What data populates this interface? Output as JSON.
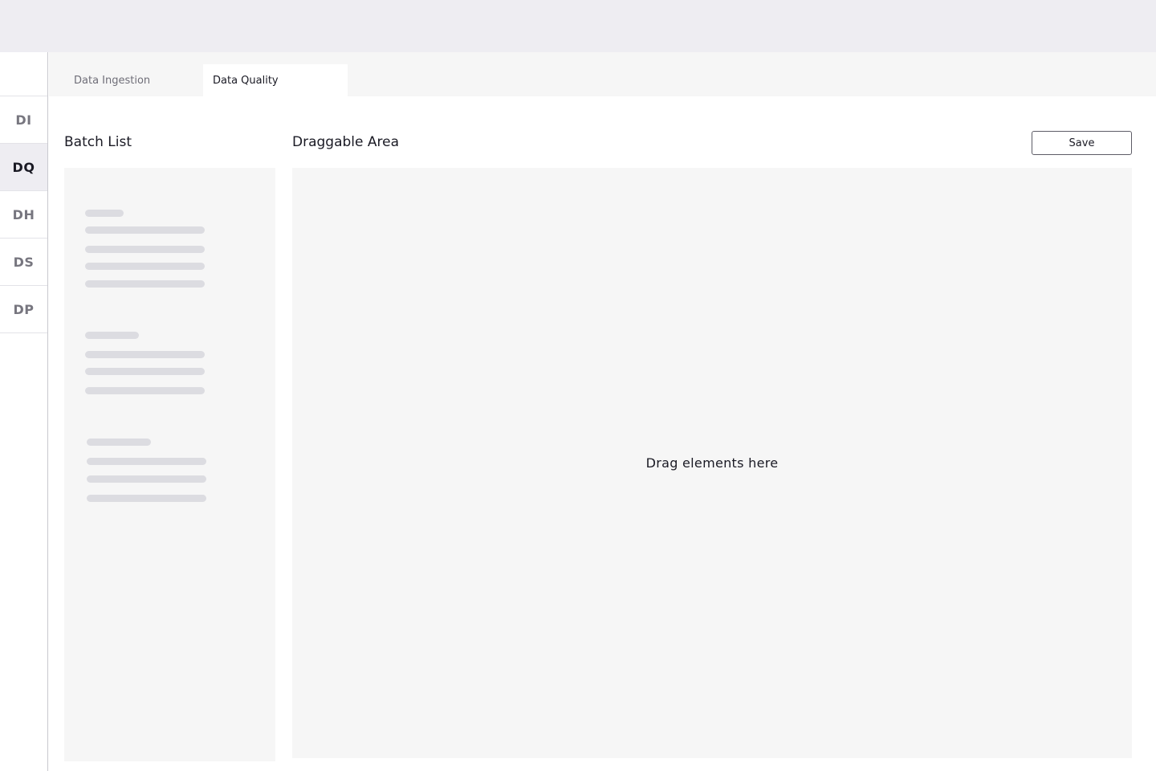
{
  "sidebar": {
    "items": [
      {
        "label": "DI",
        "active": false
      },
      {
        "label": "DQ",
        "active": true
      },
      {
        "label": "DH",
        "active": false
      },
      {
        "label": "DS",
        "active": false
      },
      {
        "label": "DP",
        "active": false
      }
    ]
  },
  "tabs": [
    {
      "label": "Data Ingestion",
      "active": false
    },
    {
      "label": "Data Quality",
      "active": true
    }
  ],
  "batch_list": {
    "title": "Batch List",
    "loading": true
  },
  "draggable_area": {
    "title": "Draggable Area",
    "hint": "Drag elements here"
  },
  "toolbar": {
    "save_label": "Save"
  },
  "colors": {
    "topbar_bg": "#eeedf2",
    "panel_bg": "#f6f6f6",
    "skeleton": "#dcdce1",
    "text_primary": "#1a1a24",
    "text_muted": "#77767f"
  }
}
